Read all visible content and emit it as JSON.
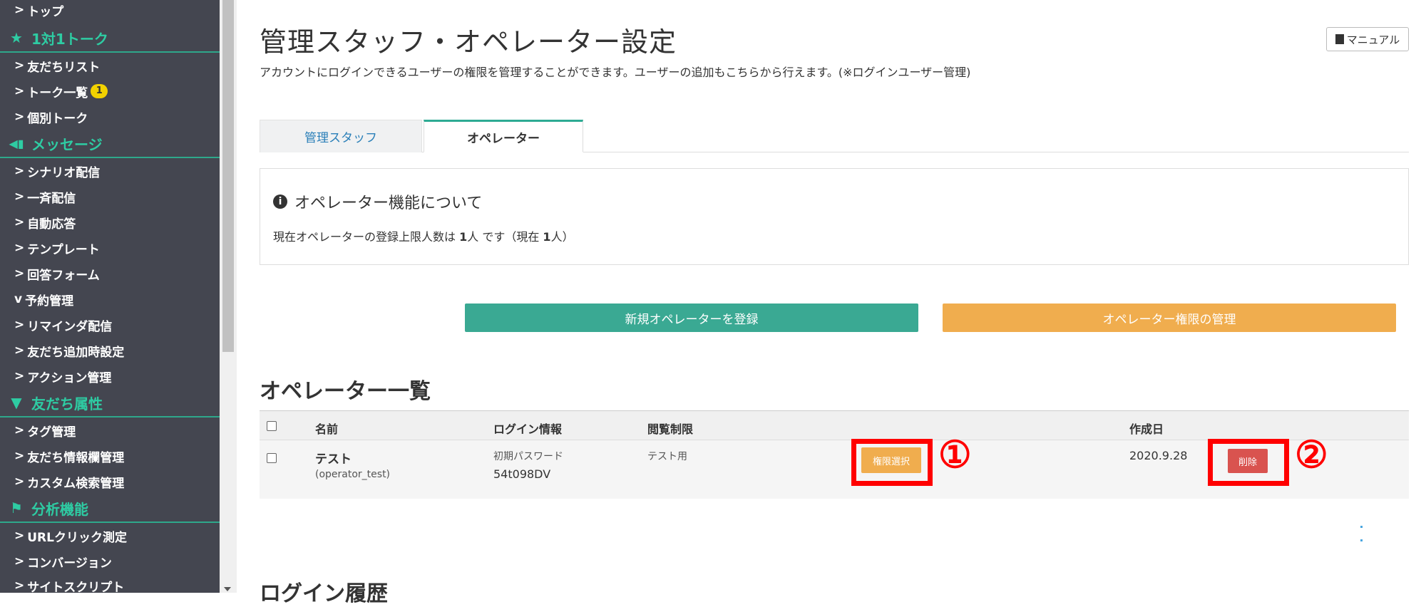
{
  "sidebar": {
    "items": [
      {
        "label": "トップ",
        "chev": ">"
      },
      {
        "label": "1対1トーク",
        "icon": "star-icon",
        "glyph": "★"
      },
      {
        "label": "友だちリスト",
        "chev": ">"
      },
      {
        "label": "トーク一覧",
        "chev": ">",
        "badge": "1"
      },
      {
        "label": "個別トーク",
        "chev": ">"
      },
      {
        "label": "メッセージ",
        "icon": "megaphone-icon",
        "glyph": "📢"
      },
      {
        "label": "シナリオ配信",
        "chev": ">"
      },
      {
        "label": "一斉配信",
        "chev": ">"
      },
      {
        "label": "自動応答",
        "chev": ">"
      },
      {
        "label": "テンプレート",
        "chev": ">"
      },
      {
        "label": "回答フォーム",
        "chev": ">"
      },
      {
        "label": "予約管理",
        "chev": "v"
      },
      {
        "label": "リマインダ配信",
        "chev": ">"
      },
      {
        "label": "友だち追加時設定",
        "chev": ">"
      },
      {
        "label": "アクション管理",
        "chev": ">"
      },
      {
        "label": "友だち属性",
        "icon": "filter-icon",
        "glyph": "▼"
      },
      {
        "label": "タグ管理",
        "chev": ">"
      },
      {
        "label": "友だち情報欄管理",
        "chev": ">"
      },
      {
        "label": "カスタム検索管理",
        "chev": ">"
      },
      {
        "label": "分析機能",
        "icon": "flag-icon",
        "glyph": "⚑"
      },
      {
        "label": "URLクリック測定",
        "chev": ">"
      },
      {
        "label": "コンバージョン",
        "chev": ">"
      },
      {
        "label": "サイトスクリプト",
        "chev": ">"
      }
    ]
  },
  "header": {
    "title": "管理スタッフ・オペレーター設定",
    "description": "アカウントにログインできるユーザーの権限を管理することができます。ユーザーの追加もこちらから行えます。(※ログインユーザー管理)",
    "manual_label": "マニュアル"
  },
  "tabs": [
    {
      "label": "管理スタッフ"
    },
    {
      "label": "オペレーター"
    }
  ],
  "info": {
    "heading": "オペレーター機能について",
    "text_before": "現在オペレーターの登録上限人数は ",
    "limit": "1",
    "text_mid": "人 です（現在 ",
    "current": "1",
    "text_after": "人）"
  },
  "actions": {
    "register_label": "新規オペレーターを登録",
    "permission_manage_label": "オペレーター権限の管理"
  },
  "list": {
    "title": "オペレーター一覧",
    "columns": [
      "名前",
      "ログイン情報",
      "閲覧制限",
      "作成日"
    ],
    "row": {
      "name": "テスト",
      "login_id": "(operator_test)",
      "password_label": "初期パスワード",
      "password": "54t098DV",
      "restriction": "テスト用",
      "permission_button": "権限選択",
      "created": "2020.9.28",
      "delete_button": "削除"
    }
  },
  "annotations": {
    "marker_1": "①",
    "marker_2": "②",
    "color": "#ff0000"
  },
  "history": {
    "title": "ログイン履歴"
  },
  "colors": {
    "sidebar_bg": "#444650",
    "accent_green": "#2ecca3",
    "register_green": "#3aa993",
    "orange": "#f0ad4e",
    "danger": "#d9534f"
  }
}
